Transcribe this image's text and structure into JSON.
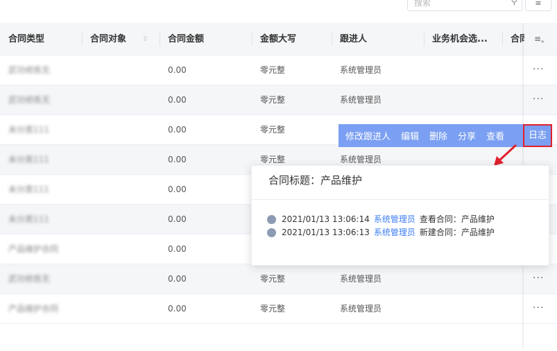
{
  "toolbar": {
    "search_placeholder": "搜索",
    "search_icon": "search-icon",
    "filter_icon": "filter-icon"
  },
  "table": {
    "columns": [
      "合同类型",
      "合同对象",
      "合同金额",
      "金额大写",
      "跟进人",
      "业务机会选...",
      "合同"
    ],
    "column_settings_icon": "column-settings-icon",
    "rows": [
      {
        "type": "武功修炼无",
        "amount": "0.00",
        "caps": "零元整",
        "follower": "系统管理员",
        "more": "···"
      },
      {
        "type": "武功修炼无",
        "amount": "0.00",
        "caps": "零元整",
        "follower": "系统管理员",
        "more": "···"
      },
      {
        "type": "未分类111",
        "amount": "0.00",
        "caps": "零元整",
        "follower": "",
        "more": ""
      },
      {
        "type": "未分类111",
        "amount": "0.00",
        "caps": "零元整",
        "follower": "系统管理员",
        "more": ""
      },
      {
        "type": "未分类111",
        "amount": "0.00",
        "caps": "",
        "follower": "",
        "more": ""
      },
      {
        "type": "未分类111",
        "amount": "0.00",
        "caps": "",
        "follower": "",
        "more": ""
      },
      {
        "type": "产品维护合同",
        "amount": "0.00",
        "caps": "",
        "follower": "",
        "more": ""
      },
      {
        "type": "武功修炼无",
        "amount": "0.00",
        "caps": "零元整",
        "follower": "系统管理员",
        "more": "···"
      },
      {
        "type": "产品维护合同",
        "amount": "0.00",
        "caps": "零元整",
        "follower": "系统管理员",
        "more": "···"
      }
    ]
  },
  "actions": {
    "change_follower": "修改跟进人",
    "edit": "编辑",
    "delete": "删除",
    "share": "分享",
    "view": "查看",
    "log": "日志"
  },
  "popover": {
    "title": "合同标题：产品维护",
    "logs": [
      {
        "time": "2021/01/13 13:06:14",
        "user": "系统管理员",
        "action": "查看合同：产品维护"
      },
      {
        "time": "2021/01/13 13:06:13",
        "user": "系统管理员",
        "action": "新建合同：产品维护"
      }
    ]
  },
  "colors": {
    "action_bar": "#7b9ff2",
    "highlight": "#e0202a",
    "link": "#3d7ef5",
    "header_bg": "#f5f6f8"
  }
}
